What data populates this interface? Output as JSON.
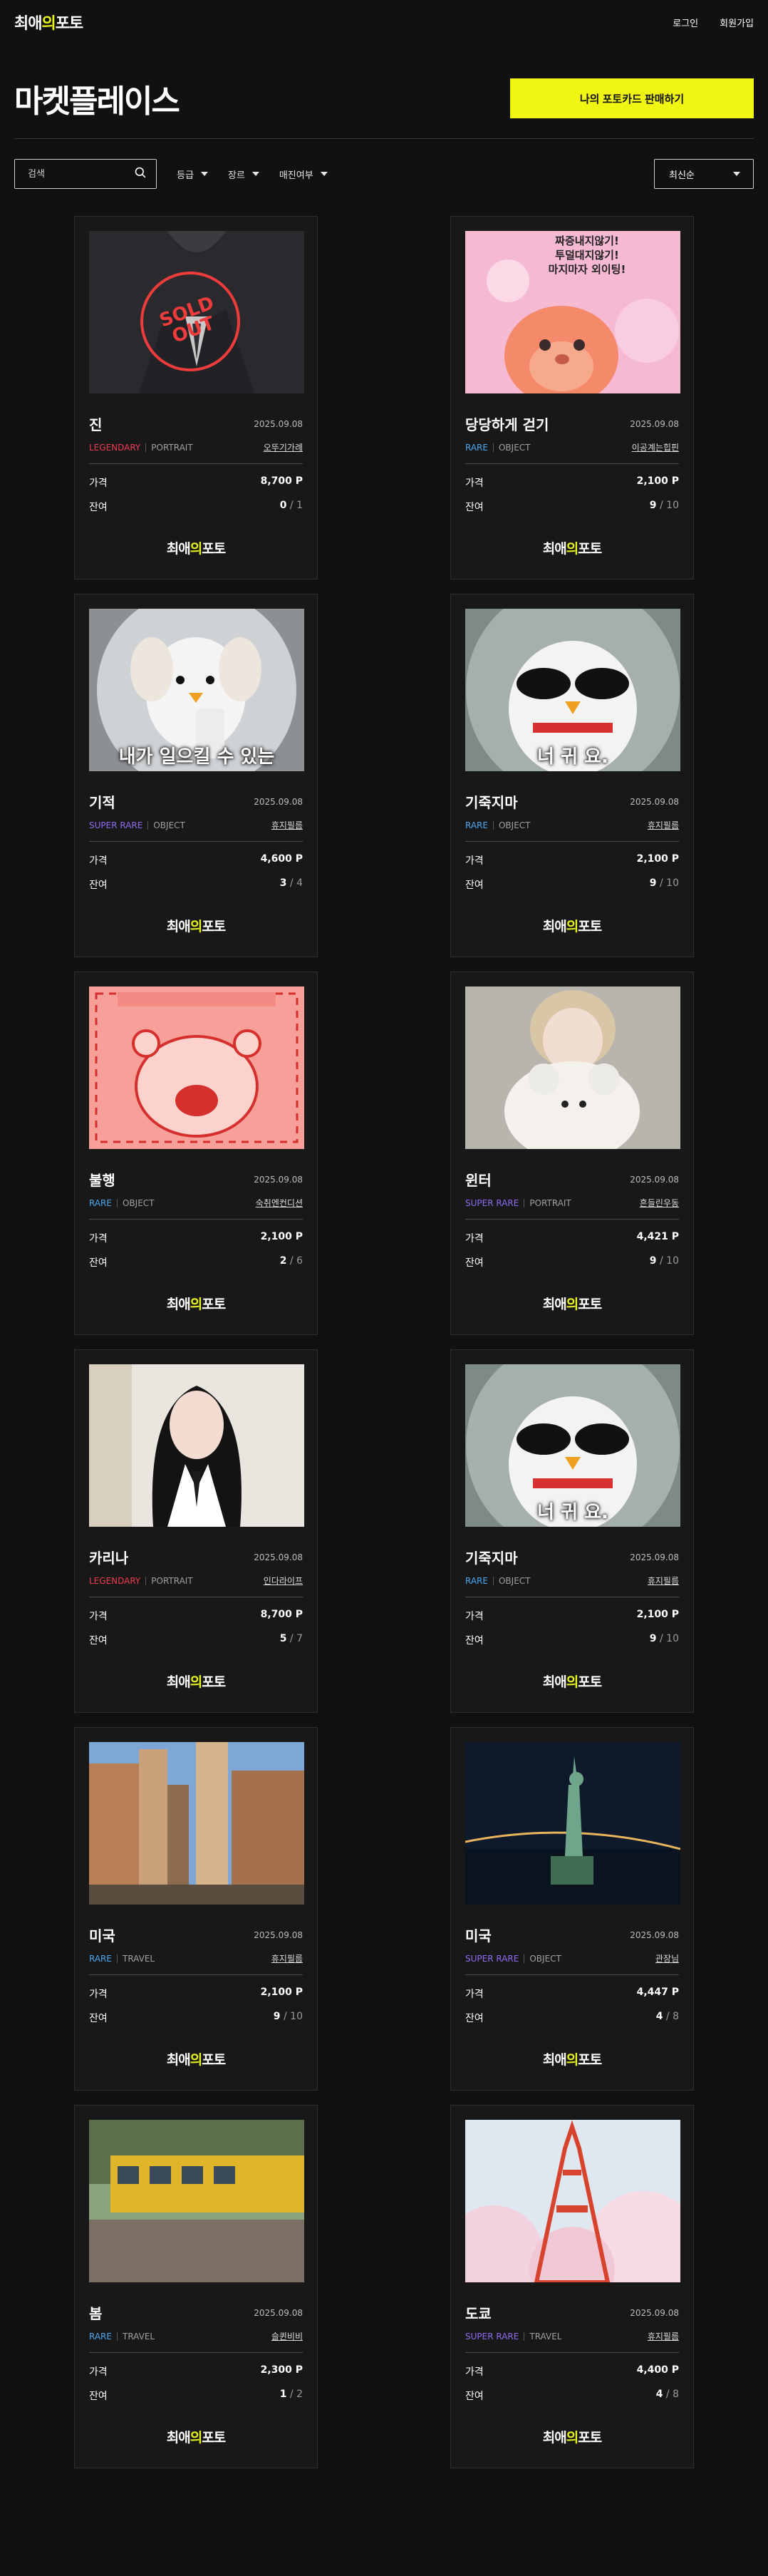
{
  "nav": {
    "logo_pre": "최애",
    "logo_hl": "의",
    "logo_post": "포토",
    "login": "로그인",
    "signup": "회원가입"
  },
  "hero": {
    "title": "마켓플레이스",
    "sell_button": "나의 포토카드 판매하기"
  },
  "filters": {
    "search_placeholder": "검색",
    "grade": "등급",
    "genre": "장르",
    "sold": "매진여부",
    "sort": "최신순"
  },
  "colors": {
    "accent": "#f0f512",
    "legendary": "#ee3b52",
    "rare": "#4aa8f0",
    "super_rare": "#8d6cf0",
    "soldout": "#ee3b3b"
  },
  "labels": {
    "price": "가격",
    "remain": "잔여",
    "remain_sep": "/"
  },
  "cards": [
    {
      "name": "진",
      "date": "2025.09.08",
      "grade": "LEGENDARY",
      "grade_key": "legendary",
      "category": "PORTRAIT",
      "seller": "오뚜기가례",
      "price": "8,700 P",
      "remain": "0",
      "total": "1",
      "sold_out_line1": "SOLD",
      "sold_out_line2": "OUT",
      "caption": ""
    },
    {
      "name": "당당하게 걷기",
      "date": "2025.09.08",
      "grade": "RARE",
      "grade_key": "rare",
      "category": "OBJECT",
      "seller": "이공계는힙핀",
      "price": "2,100 P",
      "remain": "9",
      "total": "10",
      "bubble": [
        "짜증내지않기!",
        "투덜대지않기!",
        "마지마자 외이팅!"
      ],
      "caption": ""
    },
    {
      "name": "기적",
      "date": "2025.09.08",
      "grade": "SUPER RARE",
      "grade_key": "super_rare",
      "category": "OBJECT",
      "seller": "휴지필름",
      "price": "4,600 P",
      "remain": "3",
      "total": "4",
      "caption": "내가 일으킬 수 있는"
    },
    {
      "name": "기죽지마",
      "date": "2025.09.08",
      "grade": "RARE",
      "grade_key": "rare",
      "category": "OBJECT",
      "seller": "휴지필름",
      "price": "2,100 P",
      "remain": "9",
      "total": "10",
      "caption": "너 귀 요."
    },
    {
      "name": "불행",
      "date": "2025.09.08",
      "grade": "RARE",
      "grade_key": "rare",
      "category": "OBJECT",
      "seller": "숙취엔컨디션",
      "price": "2,100 P",
      "remain": "2",
      "total": "6",
      "caption": ""
    },
    {
      "name": "윈터",
      "date": "2025.09.08",
      "grade": "SUPER RARE",
      "grade_key": "super_rare",
      "category": "PORTRAIT",
      "seller": "흔들린우동",
      "price": "4,421 P",
      "remain": "9",
      "total": "10",
      "caption": ""
    },
    {
      "name": "카리나",
      "date": "2025.09.08",
      "grade": "LEGENDARY",
      "grade_key": "legendary",
      "category": "PORTRAIT",
      "seller": "인다라이프",
      "price": "8,700 P",
      "remain": "5",
      "total": "7",
      "caption": ""
    },
    {
      "name": "기죽지마",
      "date": "2025.09.08",
      "grade": "RARE",
      "grade_key": "rare",
      "category": "OBJECT",
      "seller": "휴지필름",
      "price": "2,100 P",
      "remain": "9",
      "total": "10",
      "caption": "너 귀 요."
    },
    {
      "name": "미국",
      "date": "2025.09.08",
      "grade": "RARE",
      "grade_key": "rare",
      "category": "TRAVEL",
      "seller": "휴지필름",
      "price": "2,100 P",
      "remain": "9",
      "total": "10",
      "caption": ""
    },
    {
      "name": "미국",
      "date": "2025.09.08",
      "grade": "SUPER RARE",
      "grade_key": "super_rare",
      "category": "OBJECT",
      "seller": "관장님",
      "price": "4,447 P",
      "remain": "4",
      "total": "8",
      "caption": ""
    },
    {
      "name": "봄",
      "date": "2025.09.08",
      "grade": "RARE",
      "grade_key": "rare",
      "category": "TRAVEL",
      "seller": "슬퀸비비",
      "price": "2,300 P",
      "remain": "1",
      "total": "2",
      "caption": ""
    },
    {
      "name": "도쿄",
      "date": "2025.09.08",
      "grade": "SUPER RARE",
      "grade_key": "super_rare",
      "category": "TRAVEL",
      "seller": "휴지필름",
      "price": "4,400 P",
      "remain": "4",
      "total": "8",
      "caption": ""
    }
  ]
}
